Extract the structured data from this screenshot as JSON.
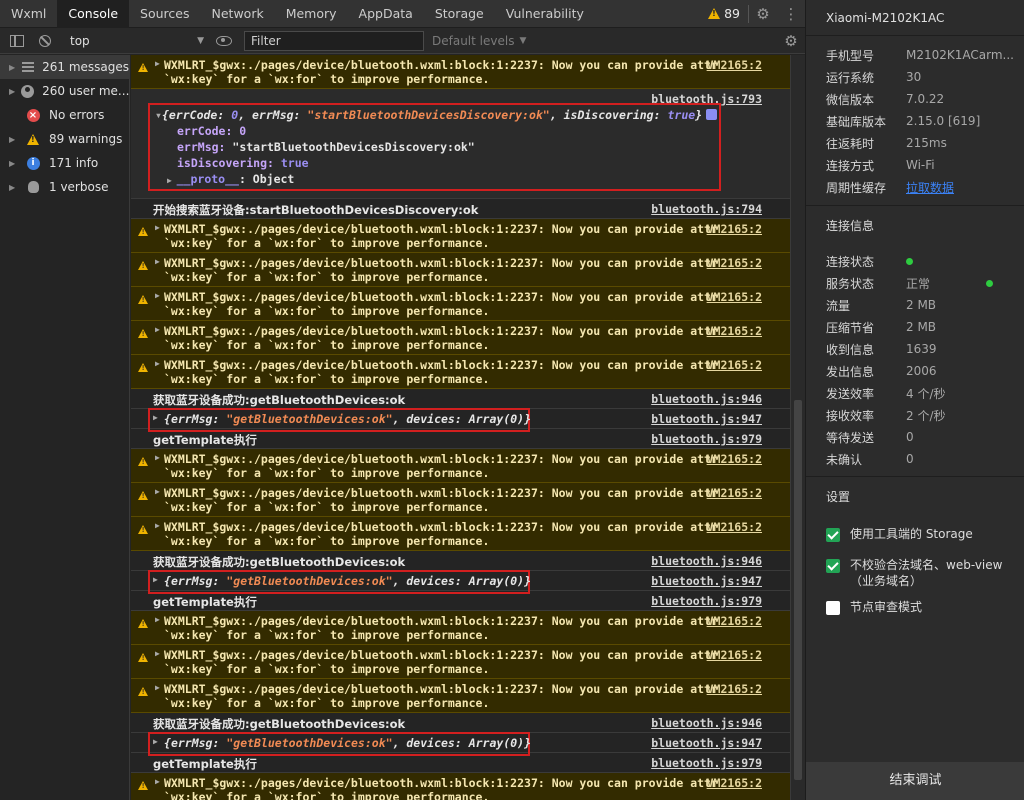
{
  "tabs": [
    "Wxml",
    "Console",
    "Sources",
    "Network",
    "Memory",
    "AppData",
    "Storage",
    "Vulnerability"
  ],
  "active_tab": "Console",
  "warning_count": "89",
  "toolbar": {
    "context": "top",
    "filter_placeholder": "Filter",
    "levels_label": "Default levels"
  },
  "sidebar": {
    "items": [
      {
        "label": "261 messages",
        "icon": "list-icon"
      },
      {
        "label": "260 user me...",
        "icon": "user-icon"
      },
      {
        "label": "No errors",
        "icon": "error-icon"
      },
      {
        "label": "89 warnings",
        "icon": "warning-icon"
      },
      {
        "label": "171 info",
        "icon": "info-icon"
      },
      {
        "label": "1 verbose",
        "icon": "bug-icon"
      }
    ]
  },
  "console": {
    "warn_line1": "WXMLRT_$gwx:./pages/device/bluetooth.wxml:block:1:2237: Now you can provide attr",
    "warn_line2": "`wx:key` for a `wx:for` to improve performance.",
    "warn_src": "VM2165:2",
    "expanded": {
      "src": "bluetooth.js:793",
      "summary_errCode_key": "errCode",
      "summary_errCode_val": "0",
      "summary_errMsg_key": "errMsg",
      "summary_errMsg_val": "\"startBluetoothDevicesDiscovery:ok\"",
      "summary_isDisc_key": "isDiscovering",
      "summary_isDisc_val": "true",
      "prop_errCode": "errCode: 0",
      "prop_errMsg_key": "errMsg: ",
      "prop_errMsg_val": "\"startBluetoothDevicesDiscovery:ok\"",
      "prop_isDisc_key": "isDiscovering: ",
      "prop_isDisc_val": "true",
      "proto_key": "__proto__",
      "proto_val": ": Object"
    },
    "start_msg": "开始搜索蓝牙设备:startBluetoothDevicesDiscovery:ok",
    "start_src": "bluetooth.js:794",
    "got_msg": "获取蓝牙设备成功:getBluetoothDevices:ok",
    "got_src": "bluetooth.js:946",
    "obj_errMsg_key": "errMsg",
    "obj_errMsg_val": "\"getBluetoothDevices:ok\"",
    "obj_devices_key": "devices",
    "obj_devices_val": "Array(0)",
    "obj_src": "bluetooth.js:947",
    "tmpl_msg": "getTemplate执行",
    "tmpl_src": "bluetooth.js:979"
  },
  "device": {
    "title": "Xiaomi-M2102K1AC",
    "rows": [
      {
        "label": "手机型号",
        "value": "M2102K1ACarm..."
      },
      {
        "label": "运行系统",
        "value": "30"
      },
      {
        "label": "微信版本",
        "value": "7.0.22"
      },
      {
        "label": "基础库版本",
        "value": "2.15.0 [619]"
      },
      {
        "label": "往返耗时",
        "value": "215ms"
      },
      {
        "label": "连接方式",
        "value": "Wi-Fi"
      },
      {
        "label": "周期性缓存",
        "value": "拉取数据"
      }
    ]
  },
  "connection": {
    "title": "连接信息",
    "rows": [
      {
        "label": "连接状态",
        "value": ""
      },
      {
        "label": "服务状态",
        "value": "正常"
      },
      {
        "label": "流量",
        "value": "2 MB"
      },
      {
        "label": "压缩节省",
        "value": "2 MB"
      },
      {
        "label": "收到信息",
        "value": "1639"
      },
      {
        "label": "发出信息",
        "value": "2006"
      },
      {
        "label": "发送效率",
        "value": "4 个/秒"
      },
      {
        "label": "接收效率",
        "value": "2 个/秒"
      },
      {
        "label": "等待发送",
        "value": "0"
      },
      {
        "label": "未确认",
        "value": "0"
      }
    ]
  },
  "settings": {
    "title": "设置",
    "options": [
      {
        "label": "使用工具端的 Storage",
        "checked": true
      },
      {
        "label": "不校验合法域名、web-view（业务域名）",
        "checked": true
      },
      {
        "label": "节点审查模式",
        "checked": false
      }
    ],
    "end_button": "结束调试"
  },
  "colors": {
    "accent_green": "#22a455",
    "warning_bg": "#332b00",
    "highlight_red": "#d21f1f"
  }
}
